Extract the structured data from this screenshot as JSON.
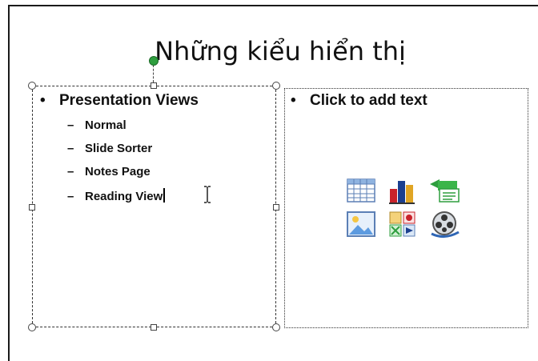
{
  "slide": {
    "title": "Những kiểu hiển thị",
    "left_placeholder": {
      "level1": {
        "bullet": "•",
        "text": "Presentation Views"
      },
      "items": [
        {
          "dash": "–",
          "text": "Normal"
        },
        {
          "dash": "–",
          "text": "Slide Sorter"
        },
        {
          "dash": "–",
          "text": "Notes Page"
        },
        {
          "dash": "–",
          "text": "Reading View"
        }
      ]
    },
    "right_placeholder": {
      "bullet": "•",
      "text": "Click to add text",
      "content_icons": [
        "table-icon",
        "chart-icon",
        "smartart-icon",
        "picture-icon",
        "clip-art-icon",
        "media-clip-icon"
      ]
    }
  },
  "colors": {
    "rotate_handle": "#2e9e3e",
    "border": "#333333"
  }
}
